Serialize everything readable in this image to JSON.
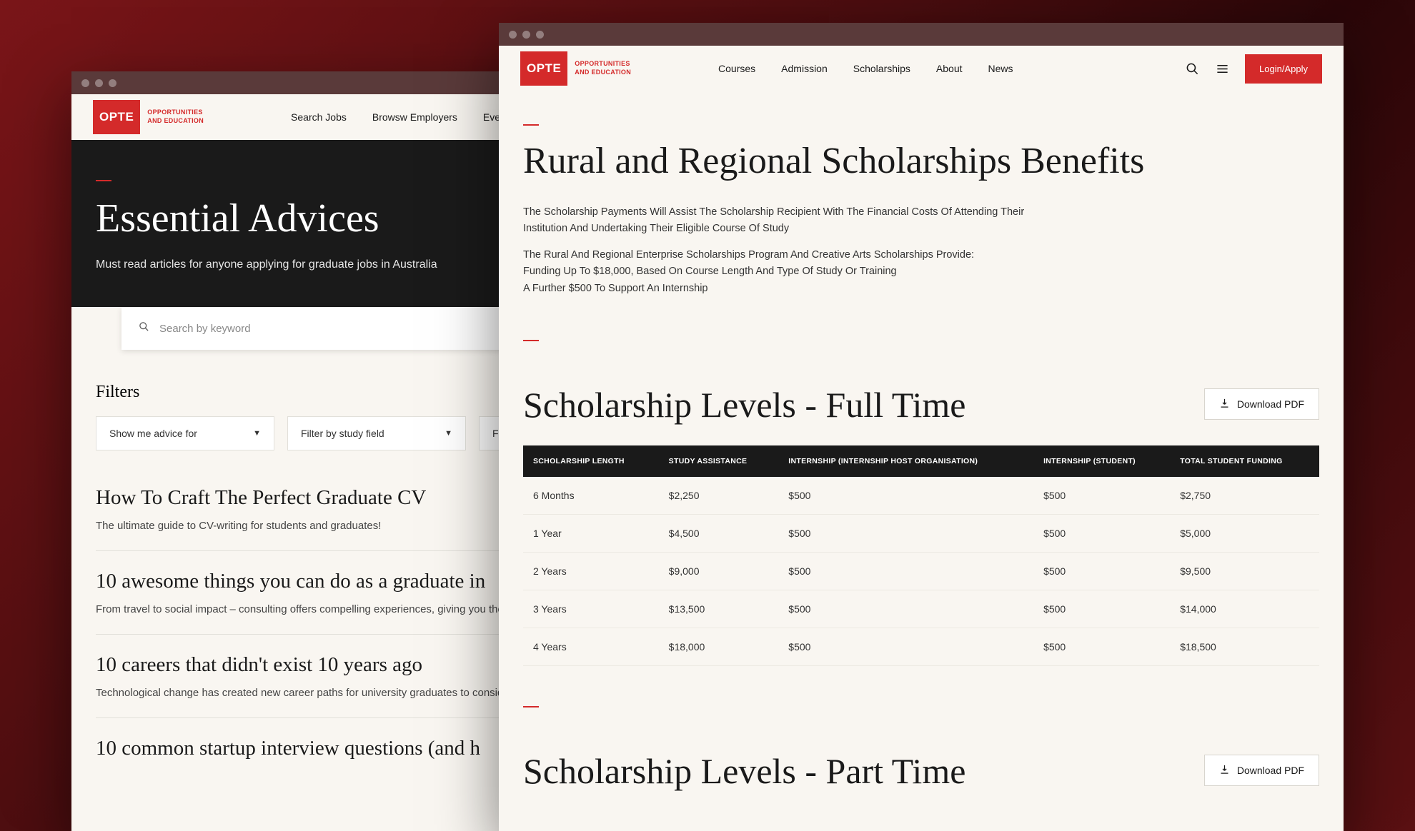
{
  "logo": {
    "abbr": "OPTE",
    "line1": "OPPORTUNITIES",
    "line2": "AND EDUCATION"
  },
  "back": {
    "nav": [
      "Search Jobs",
      "Browsw Employers",
      "Even"
    ],
    "hero": {
      "title": "Essential Advices",
      "subtitle": "Must read articles for anyone applying for graduate jobs in Australia"
    },
    "search_placeholder": "Search by keyword",
    "filters_title": "Filters",
    "filter1": "Show me advice for",
    "filter2": "Filter by study field",
    "filter3": "Fi",
    "articles": [
      {
        "title": "How To Craft The Perfect Graduate CV",
        "desc": "The ultimate guide to CV-writing for students and graduates!"
      },
      {
        "title": "10 awesome things you can do as a graduate in",
        "desc": "From travel to social impact – consulting offers compelling experiences, giving you the op"
      },
      {
        "title": "10 careers that didn't exist 10 years ago",
        "desc": "Technological change has created new career paths for university graduates to consider –"
      },
      {
        "title": "10 common startup interview questions (and h",
        "desc": ""
      }
    ]
  },
  "front": {
    "nav": [
      "Courses",
      "Admission",
      "Scholarships",
      "About",
      "News"
    ],
    "login": "Login/Apply",
    "page_title": "Rural and Regional Scholarships Benefits",
    "body_p1": "The Scholarship Payments Will Assist The Scholarship Recipient With The Financial Costs Of Attending Their Institution And Undertaking Their Eligible Course Of Study",
    "body_p2a": "The Rural And Regional Enterprise Scholarships Program And Creative Arts Scholarships Provide:",
    "body_p2b": "Funding Up To $18,000, Based On Course Length And Type Of Study Or Training",
    "body_p2c": "A Further $500 To Support An Internship",
    "section1_title": "Scholarship Levels - Full Time",
    "section2_title": "Scholarship Levels - Part Time",
    "download_label": "Download PDF",
    "table": {
      "headers": [
        "SCHOLARSHIP LENGTH",
        "STUDY ASSISTANCE",
        "INTERNSHIP (INTERNSHIP HOST ORGANISATION)",
        "INTERNSHIP (STUDENT)",
        "TOTAL STUDENT FUNDING"
      ],
      "rows": [
        [
          "6 Months",
          "$2,250",
          "$500",
          "$500",
          "$2,750"
        ],
        [
          "1 Year",
          "$4,500",
          "$500",
          "$500",
          "$5,000"
        ],
        [
          "2 Years",
          "$9,000",
          "$500",
          "$500",
          "$9,500"
        ],
        [
          "3 Years",
          "$13,500",
          "$500",
          "$500",
          "$14,000"
        ],
        [
          "4 Years",
          "$18,000",
          "$500",
          "$500",
          "$18,500"
        ]
      ]
    }
  }
}
